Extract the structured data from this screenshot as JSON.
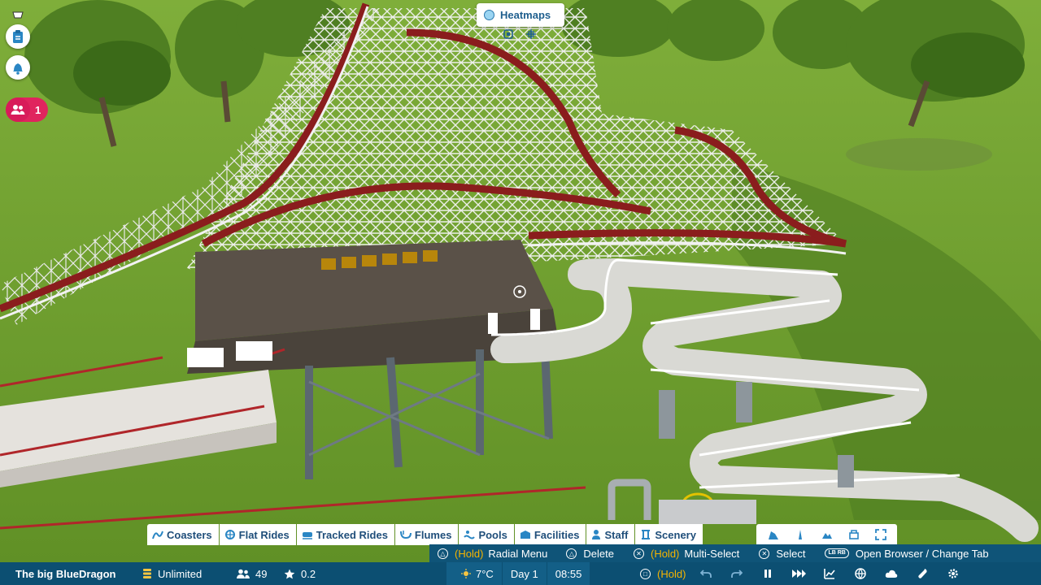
{
  "heatmaps": {
    "label": "Heatmaps"
  },
  "notifications": {
    "guest_count": "1"
  },
  "categories": [
    {
      "label": "Coasters",
      "icon": "coaster-icon"
    },
    {
      "label": "Flat Rides",
      "icon": "flat-ride-icon"
    },
    {
      "label": "Tracked Rides",
      "icon": "tracked-ride-icon"
    },
    {
      "label": "Flumes",
      "icon": "flume-icon"
    },
    {
      "label": "Pools",
      "icon": "pool-icon"
    },
    {
      "label": "Facilities",
      "icon": "facility-icon"
    },
    {
      "label": "Staff",
      "icon": "staff-icon"
    },
    {
      "label": "Scenery",
      "icon": "scenery-icon"
    }
  ],
  "tools": [
    "terrain-icon",
    "path-icon",
    "landscape-icon",
    "blueprint-icon",
    "expand-icon"
  ],
  "hints": {
    "hold": "(Hold)",
    "radial_menu": "Radial Menu",
    "delete": "Delete",
    "multi_select": "Multi-Select",
    "select": "Select",
    "lb_rb": "LB RB",
    "open_browser": "Open Browser / Change Tab"
  },
  "status": {
    "park_name": "The big BlueDragon",
    "money": "Unlimited",
    "guests": "49",
    "rating": "0.2",
    "temperature": "7°C",
    "day": "Day 1",
    "time": "08:55",
    "hold": "(Hold)"
  },
  "colors": {
    "ui_blue": "#0c4f72",
    "accent_text": "#1f4e7a",
    "guest_pink": "#e0245e",
    "hold_yellow": "#f5b400"
  }
}
